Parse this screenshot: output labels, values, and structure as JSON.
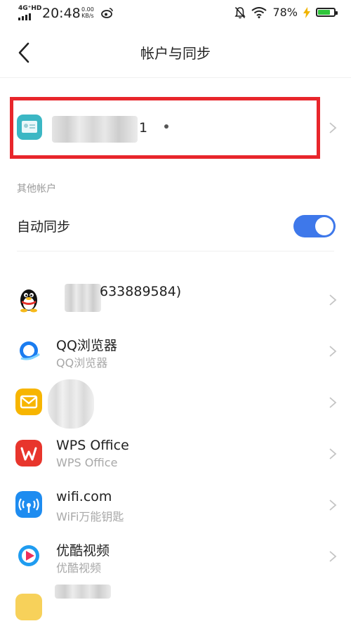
{
  "status_bar": {
    "network": "4G⁺HD",
    "time": "20:48",
    "speed_value": "0.00",
    "speed_unit": "KB/s",
    "battery": "78%",
    "battery_level": 0.78,
    "battery_color": "#2fc53b"
  },
  "header": {
    "title": "帐户与同步"
  },
  "main_account": {
    "name_tail": "1"
  },
  "highlight_color": "#e8262b",
  "other_accounts": {
    "title": "其他帐户"
  },
  "auto_sync": {
    "label": "自动同步",
    "enabled": true,
    "toggle_color": "#3e78ea"
  },
  "accounts": [
    {
      "icon": "qq-penguin-icon",
      "name": "633889584)",
      "subtitle": ""
    },
    {
      "icon": "qq-browser-icon",
      "name": "QQ浏览器",
      "subtitle": "QQ浏览器"
    },
    {
      "icon": "mail-icon",
      "name": "",
      "subtitle": ""
    },
    {
      "icon": "wps-office-icon",
      "name": "WPS Office",
      "subtitle": "WPS Office"
    },
    {
      "icon": "wifi-key-icon",
      "name": "wifi.com",
      "subtitle": "WiFi万能钥匙"
    },
    {
      "icon": "youku-icon",
      "name": "优酷视频",
      "subtitle": "优酷视频"
    }
  ]
}
